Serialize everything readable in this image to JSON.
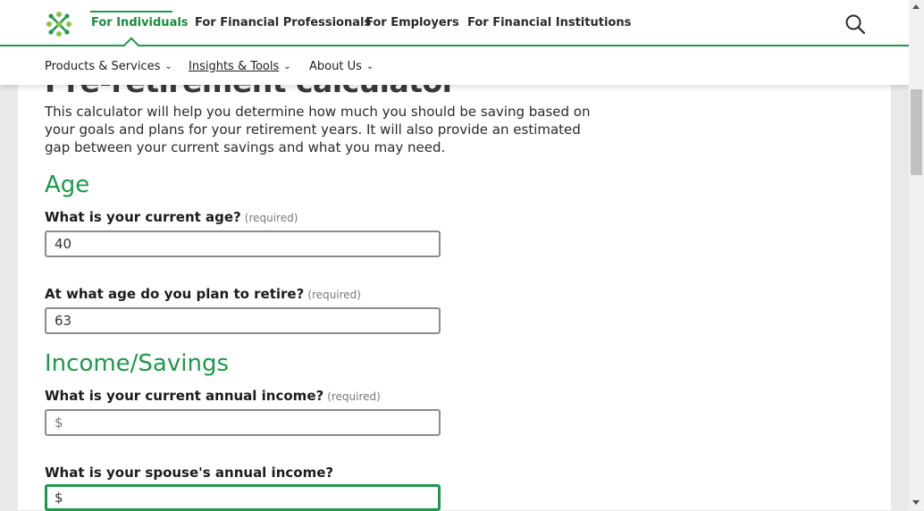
{
  "header": {
    "nav_links": [
      {
        "label": "For Individuals",
        "active": true
      },
      {
        "label": "For Financial Professionals",
        "active": false
      },
      {
        "label": "For Employers",
        "active": false
      },
      {
        "label": "For Financial Institutions",
        "active": false
      }
    ],
    "sub_nav": [
      {
        "label": "Products & Services"
      },
      {
        "label": "Insights & Tools"
      },
      {
        "label": "About Us"
      }
    ]
  },
  "colors": {
    "brand_green": "#1a9a4a",
    "text": "#1c1c1c"
  },
  "main": {
    "page_title": "Pre-retirement calculator",
    "intro": "This calculator will help you determine how much you should be saving based on your goals and plans for your retirement years. It will also provide an estimated gap between your current savings and what you may need.",
    "sections": {
      "age": {
        "heading": "Age",
        "current_age": {
          "label": "What is your current age?",
          "required": "(required)",
          "value": "40"
        },
        "retire_age": {
          "label": "At what age do you plan to retire?",
          "required": "(required)",
          "value": "63"
        }
      },
      "income": {
        "heading": "Income/Savings",
        "annual_income": {
          "label": "What is your current annual income?",
          "required": "(required)",
          "placeholder": "$"
        },
        "spouse_income": {
          "label": "What is your spouse's annual income?",
          "value": "$"
        }
      }
    }
  },
  "icons": {
    "logo": "flower-logo-icon",
    "search": "search-icon",
    "chevron": "chevron-down-icon"
  }
}
